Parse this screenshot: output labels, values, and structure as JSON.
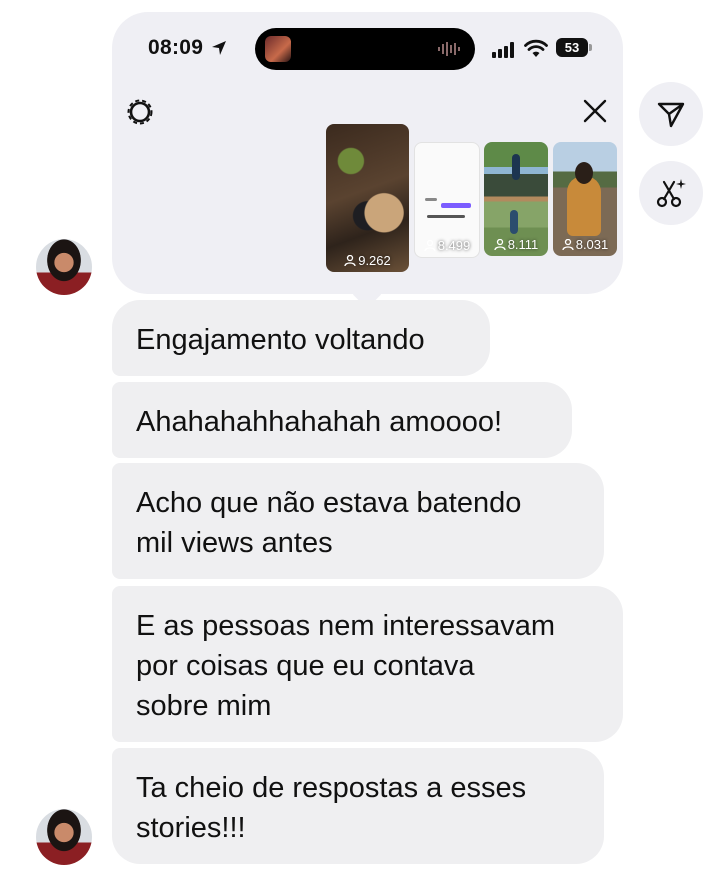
{
  "status_bar": {
    "time": "08:09",
    "battery": "53"
  },
  "story_card": {
    "thumbnails": [
      {
        "views": "9.262"
      },
      {
        "views": "8.499"
      },
      {
        "views": "8.111"
      },
      {
        "views": "8.031"
      }
    ]
  },
  "messages": [
    {
      "text": "Engajamento voltando"
    },
    {
      "text": "Ahahahahhahahah amoooo!"
    },
    {
      "text": "Acho que não estava batendo\nmil views antes"
    },
    {
      "text": "E as pessoas nem interessavam\npor coisas que eu contava\nsobre mim"
    },
    {
      "text": "Ta cheio de respostas a esses\nstories!!!"
    }
  ],
  "icons": {
    "settings": "gear-icon",
    "close": "close-icon",
    "share": "paper-plane-icon",
    "remix": "scissors-sparkle-icon"
  }
}
